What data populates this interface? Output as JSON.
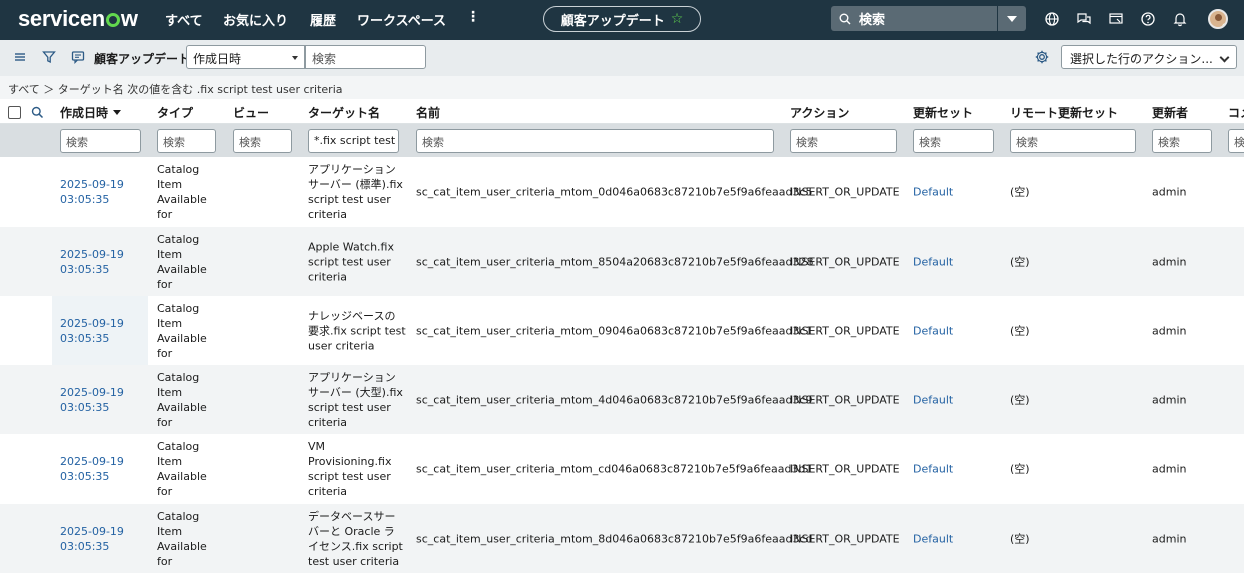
{
  "nav": {
    "logo_pre": "servicen",
    "logo_post": "w",
    "items": [
      "すべて",
      "お気に入り",
      "履歴",
      "ワークスペース"
    ],
    "more": "⋮",
    "context_title": "顧客アップデート",
    "context_star": "☆",
    "search_placeholder": "検索",
    "icons": [
      "globe-icon",
      "chat-icon",
      "screen-icon",
      "help-icon",
      "bell-icon",
      "user-avatar"
    ]
  },
  "toolbar": {
    "title": "顧客アップデート",
    "field_select": "作成日時",
    "search_placeholder": "検索",
    "action_select": "選択した行のアクション..."
  },
  "breadcrumb": "すべて ＞ ターゲット名 次の値を含む .fix script test user criteria",
  "columns": [
    "作成日時",
    "タイプ",
    "ビュー",
    "ターゲット名",
    "名前",
    "アクション",
    "更新セット",
    "リモート更新セット",
    "更新者",
    "コメ"
  ],
  "filters": [
    "検索",
    "検索",
    "検索",
    "*.fix script test u",
    "検索",
    "検索",
    "検索",
    "検索",
    "検索",
    "検索"
  ],
  "rows": [
    {
      "created": [
        "2025-09-19",
        "03:05:35"
      ],
      "type": [
        "Catalog",
        "Item",
        "Available",
        "for"
      ],
      "view": "",
      "target": [
        "アプリケーション",
        "サーバー (標準).fix",
        "script test user",
        "criteria"
      ],
      "name": "sc_cat_item_user_criteria_mtom_0d046a0683c87210b7e5f9a6feaad3c5",
      "action": "INSERT_OR_UPDATE",
      "update_set": "Default",
      "remote": "(空)",
      "updated_by": "admin"
    },
    {
      "created": [
        "2025-09-19",
        "03:05:35"
      ],
      "type": [
        "Catalog",
        "Item",
        "Available",
        "for"
      ],
      "view": "",
      "target": [
        "Apple Watch.fix",
        "script test user",
        "criteria"
      ],
      "name": "sc_cat_item_user_criteria_mtom_8504a20683c87210b7e5f9a6feaad328",
      "action": "INSERT_OR_UPDATE",
      "update_set": "Default",
      "remote": "(空)",
      "updated_by": "admin"
    },
    {
      "created": [
        "2025-09-19",
        "03:05:35"
      ],
      "type": [
        "Catalog",
        "Item",
        "Available",
        "for"
      ],
      "view": "",
      "target": [
        "ナレッジベースの",
        "要求.fix script test",
        "user criteria"
      ],
      "name": "sc_cat_item_user_criteria_mtom_09046a0683c87210b7e5f9a6feaad3c1",
      "action": "INSERT_OR_UPDATE",
      "update_set": "Default",
      "remote": "(空)",
      "updated_by": "admin"
    },
    {
      "created": [
        "2025-09-19",
        "03:05:35"
      ],
      "type": [
        "Catalog",
        "Item",
        "Available",
        "for"
      ],
      "view": "",
      "target": [
        "アプリケーション",
        "サーバー (大型).fix",
        "script test user",
        "criteria"
      ],
      "name": "sc_cat_item_user_criteria_mtom_4d046a0683c87210b7e5f9a6feaad3c9",
      "action": "INSERT_OR_UPDATE",
      "update_set": "Default",
      "remote": "(空)",
      "updated_by": "admin"
    },
    {
      "created": [
        "2025-09-19",
        "03:05:35"
      ],
      "type": [
        "Catalog",
        "Item",
        "Available",
        "for"
      ],
      "view": "",
      "target": [
        "VM",
        "Provisioning.fix",
        "script test user",
        "criteria"
      ],
      "name": "sc_cat_item_user_criteria_mtom_cd046a0683c87210b7e5f9a6feaad3d1",
      "action": "INSERT_OR_UPDATE",
      "update_set": "Default",
      "remote": "(空)",
      "updated_by": "admin"
    },
    {
      "created": [
        "2025-09-19",
        "03:05:35"
      ],
      "type": [
        "Catalog",
        "Item",
        "Available",
        "for"
      ],
      "view": "",
      "target": [
        "データベースサー",
        "バーと Oracle ラ",
        "イセンス.fix script",
        "test user criteria"
      ],
      "name": "sc_cat_item_user_criteria_mtom_8d046a0683c87210b7e5f9a6feaad3cd",
      "action": "INSERT_OR_UPDATE",
      "update_set": "Default",
      "remote": "(空)",
      "updated_by": "admin"
    }
  ]
}
